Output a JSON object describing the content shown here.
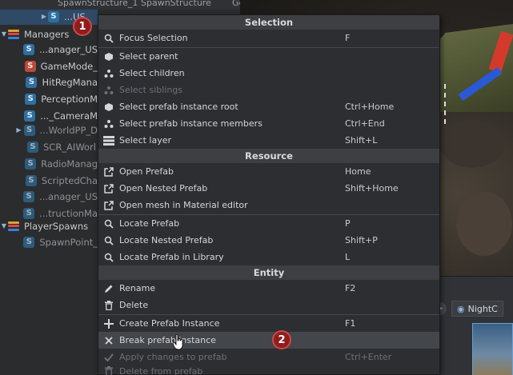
{
  "tree_header": {
    "col1": "SpawnStructure_1",
    "col2": "SpawnStructure",
    "col3": "Ge"
  },
  "hierarchy": {
    "items": [
      {
        "label": "...US",
        "kind": "script",
        "selected": true,
        "expand": "collapsed"
      },
      {
        "label": "Managers",
        "kind": "group",
        "expand": "expanded"
      },
      {
        "label": "...anager_US",
        "kind": "script"
      },
      {
        "label": "GameMode_",
        "kind": "script-red"
      },
      {
        "label": "HitRegMana",
        "kind": "script"
      },
      {
        "label": "PerceptionM",
        "kind": "script"
      },
      {
        "label": "..._CameraM",
        "kind": "script"
      },
      {
        "label": "...WorldPP_D",
        "kind": "script",
        "dim": true,
        "expand": "collapsed"
      },
      {
        "label": "SCR_AIWorl",
        "kind": "script",
        "dim": true
      },
      {
        "label": "RadioManag",
        "kind": "script",
        "dim": true
      },
      {
        "label": "ScriptedCha",
        "kind": "script",
        "dim": true
      },
      {
        "label": "...anager_US",
        "kind": "script",
        "dim": true
      },
      {
        "label": "...tructionMa",
        "kind": "script",
        "dim": true
      },
      {
        "label": "PlayerSpawns",
        "kind": "group",
        "expand": "expanded"
      },
      {
        "label": "SpawnPoint_",
        "kind": "script",
        "dim": true
      }
    ]
  },
  "menu": {
    "sections": {
      "selection": "Selection",
      "resource": "Resource",
      "entity": "Entity"
    },
    "items": {
      "focus_selection": {
        "label": "Focus Selection",
        "shortcut": "F",
        "icon": "search-icon"
      },
      "select_parent": {
        "label": "Select parent",
        "shortcut": "",
        "icon": "cube-icon"
      },
      "select_children": {
        "label": "Select children",
        "shortcut": "",
        "icon": "hierarchy-icon"
      },
      "select_siblings": {
        "label": "Select siblings",
        "shortcut": "",
        "icon": "hierarchy-icon"
      },
      "select_prefab_root": {
        "label": "Select prefab instance root",
        "shortcut": "Ctrl+Home",
        "icon": "cube-icon"
      },
      "select_prefab_members": {
        "label": "Select prefab instance members",
        "shortcut": "Ctrl+End",
        "icon": "hierarchy-icon"
      },
      "select_layer": {
        "label": "Select layer",
        "shortcut": "Shift+L",
        "icon": "layers-icon"
      },
      "open_prefab": {
        "label": "Open Prefab",
        "shortcut": "Home",
        "icon": "external-link-icon"
      },
      "open_nested_prefab": {
        "label": "Open Nested Prefab",
        "shortcut": "Shift+Home",
        "icon": "external-link-icon"
      },
      "open_mesh": {
        "label": "Open mesh in Material editor",
        "shortcut": "",
        "icon": "external-link-icon"
      },
      "locate_prefab": {
        "label": "Locate Prefab",
        "shortcut": "P",
        "icon": "search-icon"
      },
      "locate_nested_prefab": {
        "label": "Locate Nested Prefab",
        "shortcut": "Shift+P",
        "icon": "search-icon"
      },
      "locate_prefab_library": {
        "label": "Locate Prefab in Library",
        "shortcut": "L",
        "icon": "search-icon"
      },
      "rename": {
        "label": "Rename",
        "shortcut": "F2",
        "icon": "pencil-icon"
      },
      "delete": {
        "label": "Delete",
        "shortcut": "",
        "icon": "trash-icon"
      },
      "create_prefab_instance": {
        "label": "Create Prefab Instance",
        "shortcut": "F1",
        "icon": "plus-icon"
      },
      "break_prefab_instance": {
        "label": "Break prefab instance",
        "shortcut": "",
        "icon": "close-icon"
      },
      "apply_changes": {
        "label": "Apply changes to prefab",
        "shortcut": "Ctrl+Enter",
        "icon": "check-icon"
      },
      "delete_from_prefab": {
        "label": "Delete from prefab",
        "shortcut": "",
        "icon": "trash-icon"
      }
    }
  },
  "bottom_panel": {
    "tab_label": "NightC"
  },
  "badges": {
    "step1": "1",
    "step2": "2"
  },
  "colors": {
    "accent": "#2f6f9e",
    "badge": "#8f1d1d",
    "menu_bg": "#2d2e31"
  }
}
